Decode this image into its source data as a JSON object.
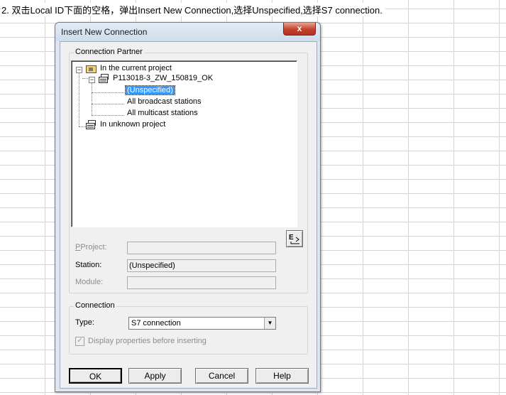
{
  "instruction": "2. 双击Local ID下面的空格，弹出Insert New Connection,选择Unspecified,选择S7 connection.",
  "dialog": {
    "title": "Insert New Connection",
    "close_symbol": "x",
    "partner_group": {
      "label": "Connection Partner",
      "tree": {
        "current_project": "In the current project",
        "project_name": "P113018-3_ZW_150819_OK",
        "unspecified": "(Unspecified)",
        "broadcast": "All broadcast stations",
        "multicast": "All multicast stations",
        "unknown_project": "In unknown project",
        "expanded_symbol": "−"
      },
      "project_label": "Project:",
      "project_value": "",
      "station_label": "Station:",
      "station_value": "(Unspecified)",
      "module_label": "Module:",
      "module_value": ""
    },
    "connection_group": {
      "label": "Connection",
      "type_label": "Type:",
      "type_value": "S7 connection",
      "display_props_label": "Display properties before inserting",
      "display_props_checked": true,
      "check_symbol": "✓",
      "dropdown_symbol": "▼"
    },
    "buttons": {
      "ok": "OK",
      "apply": "Apply",
      "cancel": "Cancel",
      "help": "Help"
    }
  }
}
